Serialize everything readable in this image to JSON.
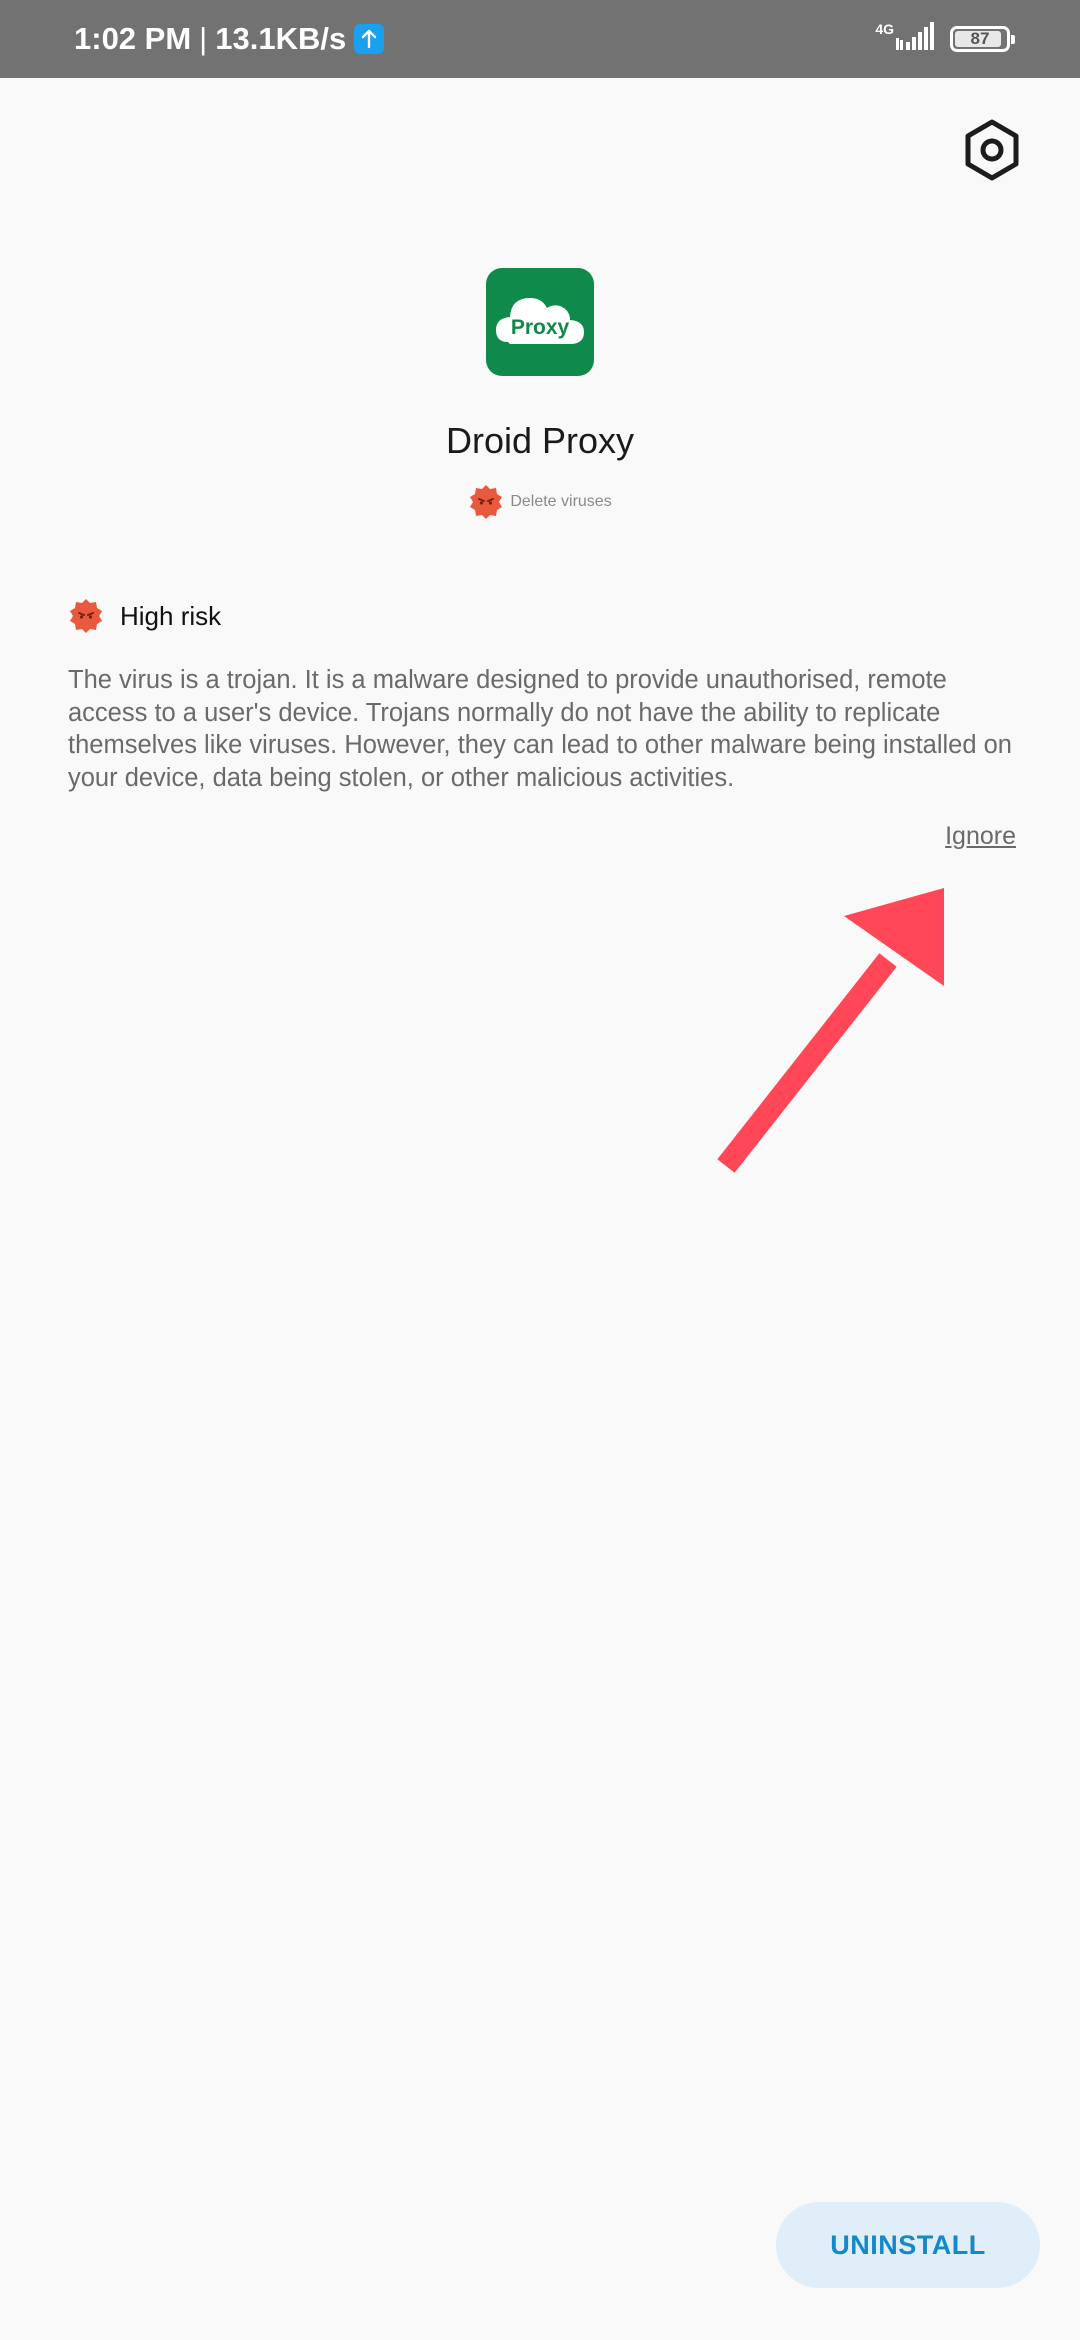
{
  "status_bar": {
    "time": "1:02 PM",
    "speed": "13.1KB/s",
    "network_type": "4G",
    "battery_level": "87",
    "upload_icon": "upload-arrow-icon",
    "signal_icon": "signal-bars-icon"
  },
  "header": {
    "settings_icon": "hexagon-gear-icon"
  },
  "app": {
    "icon_text": "Proxy",
    "name": "Droid Proxy",
    "status_label": "Delete viruses",
    "status_icon": "virus-badge-icon"
  },
  "risk": {
    "level_label": "High risk",
    "icon": "virus-badge-icon",
    "description": "The virus is a trojan. It is a malware designed to provide unauthorised, remote access to a user's device. Trojans normally do not have the ability to replicate themselves like viruses. However, they can lead to other malware being installed on your device, data being stolen, or other malicious activities."
  },
  "actions": {
    "ignore_label": "Ignore",
    "uninstall_label": "UNINSTALL"
  },
  "colors": {
    "status_bar_bg": "#727272",
    "page_bg": "#f9f9f9",
    "risk_red": "#e8593d",
    "app_icon_green": "#0f8a4a",
    "uninstall_text": "#1488c8",
    "uninstall_bg": "#dfeef8",
    "annotation_arrow": "#ff4757"
  }
}
